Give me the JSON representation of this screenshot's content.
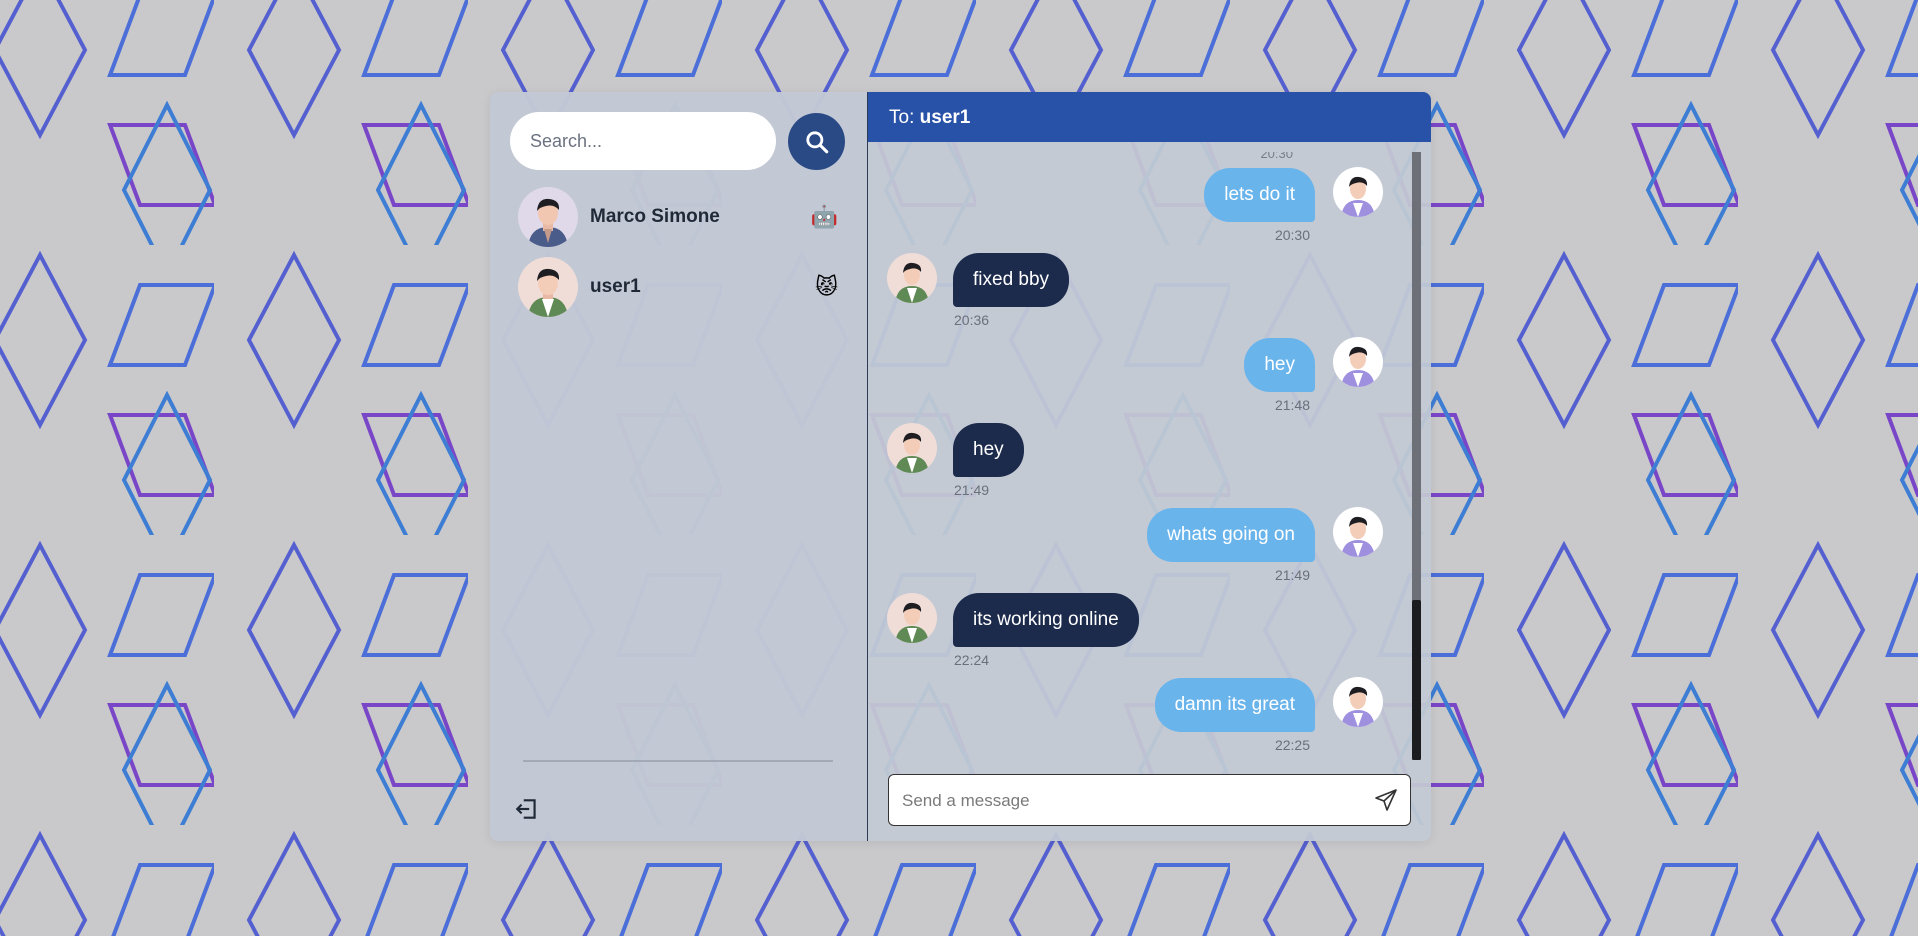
{
  "sidebar": {
    "search": {
      "placeholder": "Search..."
    },
    "search_button_icon": "search-icon",
    "conversations": [
      {
        "name": "Marco Simone",
        "badge": "🤖",
        "avatar": "avatar-man-blue-jacket"
      },
      {
        "name": "user1",
        "badge": "😾",
        "avatar": "avatar-man-green-jacket"
      }
    ],
    "logout_icon": "logout-icon"
  },
  "chat": {
    "header": {
      "to_label": "To:",
      "recipient": "user1"
    },
    "stub_time": "20:30",
    "messages": [
      {
        "direction": "sent",
        "text": "lets do it",
        "time": "20:30"
      },
      {
        "direction": "received",
        "text": "fixed bby",
        "time": "20:36"
      },
      {
        "direction": "sent",
        "text": "hey",
        "time": "21:48"
      },
      {
        "direction": "received",
        "text": "hey",
        "time": "21:49"
      },
      {
        "direction": "sent",
        "text": "whats going on",
        "time": "21:49"
      },
      {
        "direction": "received",
        "text": "its working online",
        "time": "22:24"
      },
      {
        "direction": "sent",
        "text": "damn its great",
        "time": "22:25"
      }
    ],
    "composer": {
      "placeholder": "Send a message",
      "send_icon": "send-icon"
    }
  },
  "colors": {
    "header_bg": "#2851a8",
    "search_button_bg": "#2a4a86",
    "sent_bubble": "#6ab4ec",
    "received_bubble": "#1c2a4c"
  }
}
